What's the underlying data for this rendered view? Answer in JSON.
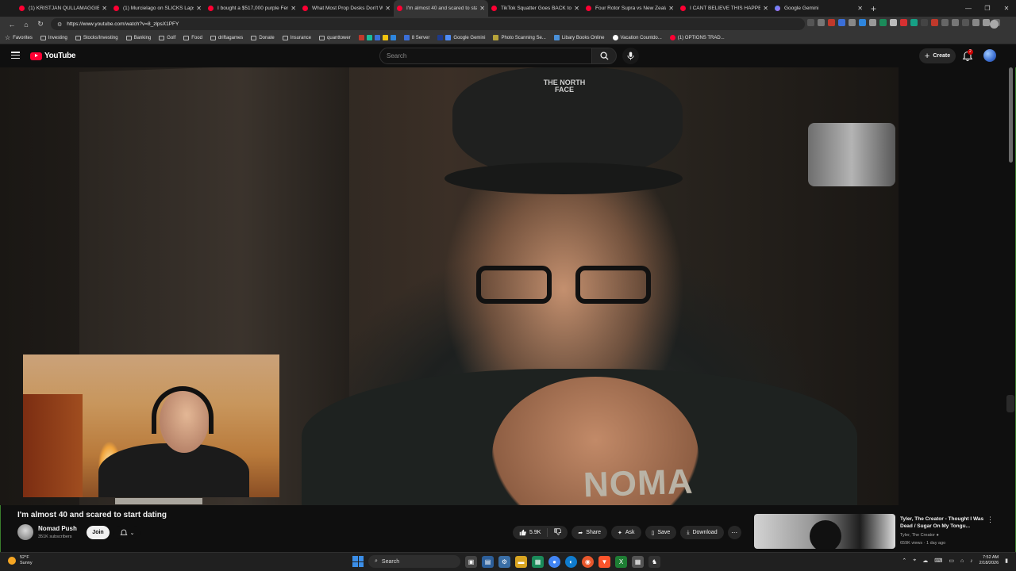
{
  "browser": {
    "tabs": [
      {
        "title": "(1) KRISTJAN QULLAMAGGIE - M...",
        "favicon": "youtube-icon",
        "active": false
      },
      {
        "title": "(1) Murcielago on SLICKS Laps the...",
        "favicon": "youtube-icon",
        "active": false
      },
      {
        "title": "I bought a $517,000 purple Ferrari...",
        "favicon": "youtube-icon",
        "active": false
      },
      {
        "title": "What Most Prop Desks Don't Wa...",
        "favicon": "youtube-icon",
        "active": false
      },
      {
        "title": "I'm almost 40 and scared to start...",
        "favicon": "youtube-icon",
        "active": true
      },
      {
        "title": "TikTok Squatter Goes BACK to $2...",
        "favicon": "youtube-icon",
        "active": false
      },
      {
        "title": "Four Rotor Supra vs New Zealand...",
        "favicon": "youtube-icon",
        "active": false
      },
      {
        "title": "I CANT BELIEVE THIS HAPPENED A...",
        "favicon": "youtube-icon",
        "active": false
      },
      {
        "title": "Google Gemini",
        "favicon": "gemini-icon",
        "active": false
      }
    ],
    "url": "https://www.youtube.com/watch?v=8_zlpsX1PFY",
    "bookmarks": [
      {
        "label": "Favorites",
        "icon": "star-icon"
      },
      {
        "label": "Investing",
        "icon": "folder-icon"
      },
      {
        "label": "Stocks/Investing",
        "icon": "folder-icon"
      },
      {
        "label": "Banking",
        "icon": "folder-icon"
      },
      {
        "label": "Golf",
        "icon": "folder-icon"
      },
      {
        "label": "Food",
        "icon": "folder-icon"
      },
      {
        "label": "driftagames",
        "icon": "folder-icon"
      },
      {
        "label": "Donate",
        "icon": "folder-icon"
      },
      {
        "label": "Insurance",
        "icon": "folder-icon"
      },
      {
        "label": "quanttower",
        "icon": "folder-icon"
      },
      {
        "label": "8 Server",
        "icon": "server-icon"
      },
      {
        "label": "Google Gemini",
        "icon": "gemini-icon"
      },
      {
        "label": "Photo Scanning Se...",
        "icon": "site-icon"
      },
      {
        "label": "Libary Books Online",
        "icon": "site-icon"
      },
      {
        "label": "Vacation Countdo...",
        "icon": "site-icon"
      },
      {
        "label": "(1) OPTIONS TRAD...",
        "icon": "youtube-icon"
      }
    ]
  },
  "youtube": {
    "logo_text": "YouTube",
    "search_placeholder": "Search",
    "create_label": "Create",
    "notification_count": "2"
  },
  "video": {
    "title": "I'm almost 40 and scared to start dating",
    "shirt_text": "NOMA",
    "hat_logo_text": "THE NORTH FACE",
    "channel_name": "Nomad Push",
    "subscribers": "351K subscribers",
    "join_label": "Join",
    "likes": "5.9K",
    "share_label": "Share",
    "ask_label": "Ask",
    "save_label": "Save",
    "download_label": "Download"
  },
  "recommendation": {
    "title": "Tyler, The Creator - Thought I Was Dead / Sugar On My Tongu...",
    "channel": "Tyler, The Creator",
    "meta": "659K views · 1 day ago"
  },
  "taskbar": {
    "temperature": "52°F",
    "weather": "Sunny",
    "search_label": "Search",
    "time": "7:52 AM",
    "date": "2/18/2026"
  },
  "colors": {
    "youtube_red": "#ff0033",
    "background": "#0f0f0f",
    "pill": "#272727",
    "window_border": "#3a7d2c"
  }
}
